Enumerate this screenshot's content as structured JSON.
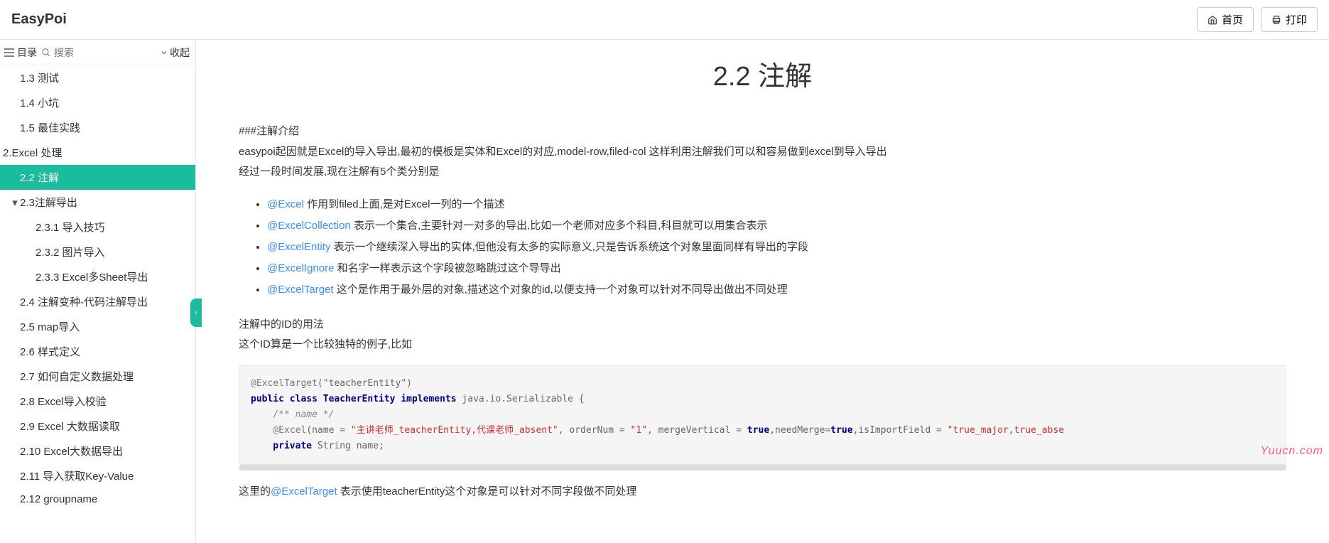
{
  "header": {
    "logo": "EasyPoi",
    "home_label": "首页",
    "print_label": "打印"
  },
  "sidebar": {
    "dir_label": "目录",
    "search_placeholder": "搜索",
    "collapse_label": "收起",
    "items": [
      {
        "label": "1.3 测试",
        "level": "l2",
        "active": false
      },
      {
        "label": "1.4 小坑",
        "level": "l2",
        "active": false
      },
      {
        "label": "1.5 最佳实践",
        "level": "l2",
        "active": false
      },
      {
        "label": "2.Excel 处理",
        "level": "section",
        "active": false
      },
      {
        "label": "2.2 注解",
        "level": "l2",
        "active": true
      },
      {
        "label": "2.3注解导出",
        "level": "l2",
        "active": false,
        "caret": "▾"
      },
      {
        "label": "2.3.1 导入技巧",
        "level": "l3",
        "active": false
      },
      {
        "label": "2.3.2 图片导入",
        "level": "l3",
        "active": false
      },
      {
        "label": "2.3.3 Excel多Sheet导出",
        "level": "l3",
        "active": false
      },
      {
        "label": "2.4 注解变种-代码注解导出",
        "level": "l2",
        "active": false
      },
      {
        "label": "2.5 map导入",
        "level": "l2",
        "active": false
      },
      {
        "label": "2.6 样式定义",
        "level": "l2",
        "active": false
      },
      {
        "label": "2.7 如何自定义数据处理",
        "level": "l2",
        "active": false
      },
      {
        "label": "2.8 Excel导入校验",
        "level": "l2",
        "active": false
      },
      {
        "label": "2.9 Excel 大数据读取",
        "level": "l2",
        "active": false
      },
      {
        "label": "2.10 Excel大数据导出",
        "level": "l2",
        "active": false
      },
      {
        "label": "2.11 导入获取Key-Value",
        "level": "l2",
        "active": false
      },
      {
        "label": "2.12 groupname",
        "level": "l2",
        "active": false
      }
    ]
  },
  "main": {
    "title": "2.2 注解",
    "intro_head": "###注解介绍",
    "intro_p1": "easypoi起因就是Excel的导入导出,最初的模板是实体和Excel的对应,model-row,filed-col 这样利用注解我们可以和容易做到excel到导入导出",
    "intro_p2": "经过一段时间发展,现在注解有5个类分别是",
    "bullets": [
      {
        "link": "@Excel",
        "text": " 作用到filed上面,是对Excel一列的一个描述"
      },
      {
        "link": "@ExcelCollection",
        "text": " 表示一个集合,主要针对一对多的导出,比如一个老师对应多个科目,科目就可以用集合表示"
      },
      {
        "link": "@ExcelEntity",
        "text": " 表示一个继续深入导出的实体,但他没有太多的实际意义,只是告诉系统这个对象里面同样有导出的字段"
      },
      {
        "link": "@ExcelIgnore",
        "text": " 和名字一样表示这个字段被忽略跳过这个导导出"
      },
      {
        "link": "@ExcelTarget",
        "text": " 这个是作用于最外层的对象,描述这个对象的id,以便支持一个对象可以针对不同导出做出不同处理"
      }
    ],
    "id_p1": "注解中的ID的用法",
    "id_p2": "这个ID算是一个比较独特的例子,比如",
    "footer_pre": "这里的",
    "footer_link": "@ExcelTarget",
    "footer_post": " 表示使用teacherEntity这个对象是可以针对不同字段做不同处理",
    "code": {
      "l1_ann": "@ExcelTarget",
      "l1_arg": "(\"teacherEntity\")",
      "l2_kw": "public class ",
      "l2_cls": "TeacherEntity",
      "l2_impl": " implements ",
      "l2_type": "java.io.Serializable {",
      "l3": "    /** name */",
      "l4_ann": "    @Excel",
      "l4_mid1": "(name = ",
      "l4_str1": "\"主讲老师_teacherEntity,代课老师_absent\"",
      "l4_mid2": ", orderNum = ",
      "l4_str2": "\"1\"",
      "l4_mid3": ", mergeVertical = ",
      "l4_kw1": "true",
      "l4_mid4": ",needMerge=",
      "l4_kw2": "true",
      "l4_mid5": ",isImportField = ",
      "l4_str3": "\"true_major,true_abse",
      "l5_kw": "    private ",
      "l5_rest": "String name;"
    }
  },
  "watermark": "Yuucn.com"
}
